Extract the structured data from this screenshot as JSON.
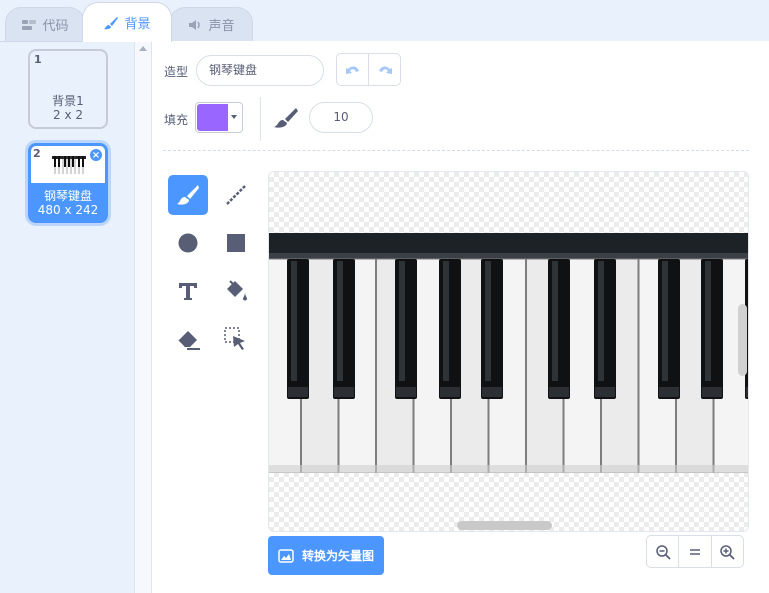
{
  "tabs": [
    {
      "label": "代码",
      "icon": "code-icon"
    },
    {
      "label": "背景",
      "icon": "brush-icon",
      "active": true
    },
    {
      "label": "声音",
      "icon": "speaker-icon"
    }
  ],
  "costumes": [
    {
      "number": "1",
      "name": "背景1",
      "size": "2 x 2"
    },
    {
      "number": "2",
      "name": "钢琴键盘",
      "size": "480 x 242",
      "selected": true
    }
  ],
  "editor": {
    "costume_label": "造型",
    "costume_name": "钢琴键盘",
    "fill_label": "填充",
    "fill_color": "#9966ff",
    "brush_size": "10",
    "convert_button": "转换为矢量图"
  },
  "tools": [
    "brush-icon",
    "line-icon",
    "circle-icon",
    "rectangle-icon",
    "text-icon",
    "fill-bucket-icon",
    "eraser-icon",
    "select-icon"
  ],
  "colors": {
    "accent": "#4c97ff",
    "tab_bg": "#e9f1fc"
  }
}
